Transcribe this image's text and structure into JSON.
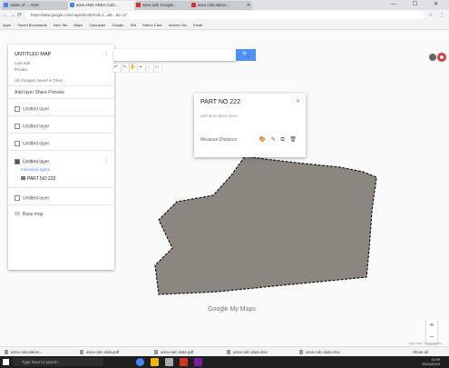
{
  "browser": {
    "tabs": [
      {
        "label": "Sales of ... AND",
        "active": false,
        "fav": "blue"
      },
      {
        "label": "area AND AREA Calc...",
        "active": true,
        "fav": "blue"
      },
      {
        "label": "area with Google...",
        "active": false,
        "fav": "red"
      },
      {
        "label": "area calculation...",
        "active": false,
        "fav": "red"
      }
    ],
    "window_controls": "— ☐ ✕",
    "address": "https://www.google.com/maps/d/edit?mid=1...&ll=..&z=17",
    "bookmarks": [
      "Apps",
      "Saved Bookmarks",
      "New Tab",
      "Maps",
      "Calculator",
      "Google",
      "SBI",
      "Ration Card",
      "Income Tax",
      "Email"
    ],
    "nav_icons": [
      "←",
      "→",
      "⟳"
    ]
  },
  "panel": {
    "title": "UNTITLED MAP",
    "sub1": "Last edit",
    "sub2": "Private",
    "add_hint": "All changes saved in Drive",
    "actions": "Add layer   Share   Preview",
    "layers": [
      {
        "label": "Untitled layer"
      },
      {
        "label": "Untitled layer"
      },
      {
        "label": "Untitled layer"
      },
      {
        "label": "Untitled layer"
      },
      {
        "label": "Untitled layer"
      }
    ],
    "selected_layer": "Untitled layer",
    "selected_style": "Individual styles",
    "selected_item": "PART NO 222",
    "base_map": "Base map"
  },
  "search": {
    "placeholder": "",
    "button": "🔍"
  },
  "tools": [
    "↶",
    "↷",
    "✋",
    "⌖",
    "⟋",
    "▭"
  ],
  "popup": {
    "title": "PART NO 222",
    "close": "✕",
    "description": "add description here",
    "measure_label": "Measure Distance",
    "actions": "🎨 ✎ ⧉ 🗑"
  },
  "map": {
    "logo": "Google My Maps",
    "attribution": "Map data ©2019  Terms",
    "zoom_in": "+",
    "zoom_out": "−"
  },
  "downloads": [
    "area calculation...",
    "area-calc-data.pdf",
    "area-calc-data.pdf",
    "area-calc-data.xlsx",
    "area-calc-data.xlsx"
  ],
  "downloads_show_all": "Show all",
  "taskbar": {
    "search_text": "Type here to search",
    "time": "11:09",
    "date": "03/04/2019"
  },
  "colors": {
    "polygon_fill": "#8b8680",
    "polygon_stroke": "#1a1a1a",
    "accent": "#4d90fe"
  }
}
